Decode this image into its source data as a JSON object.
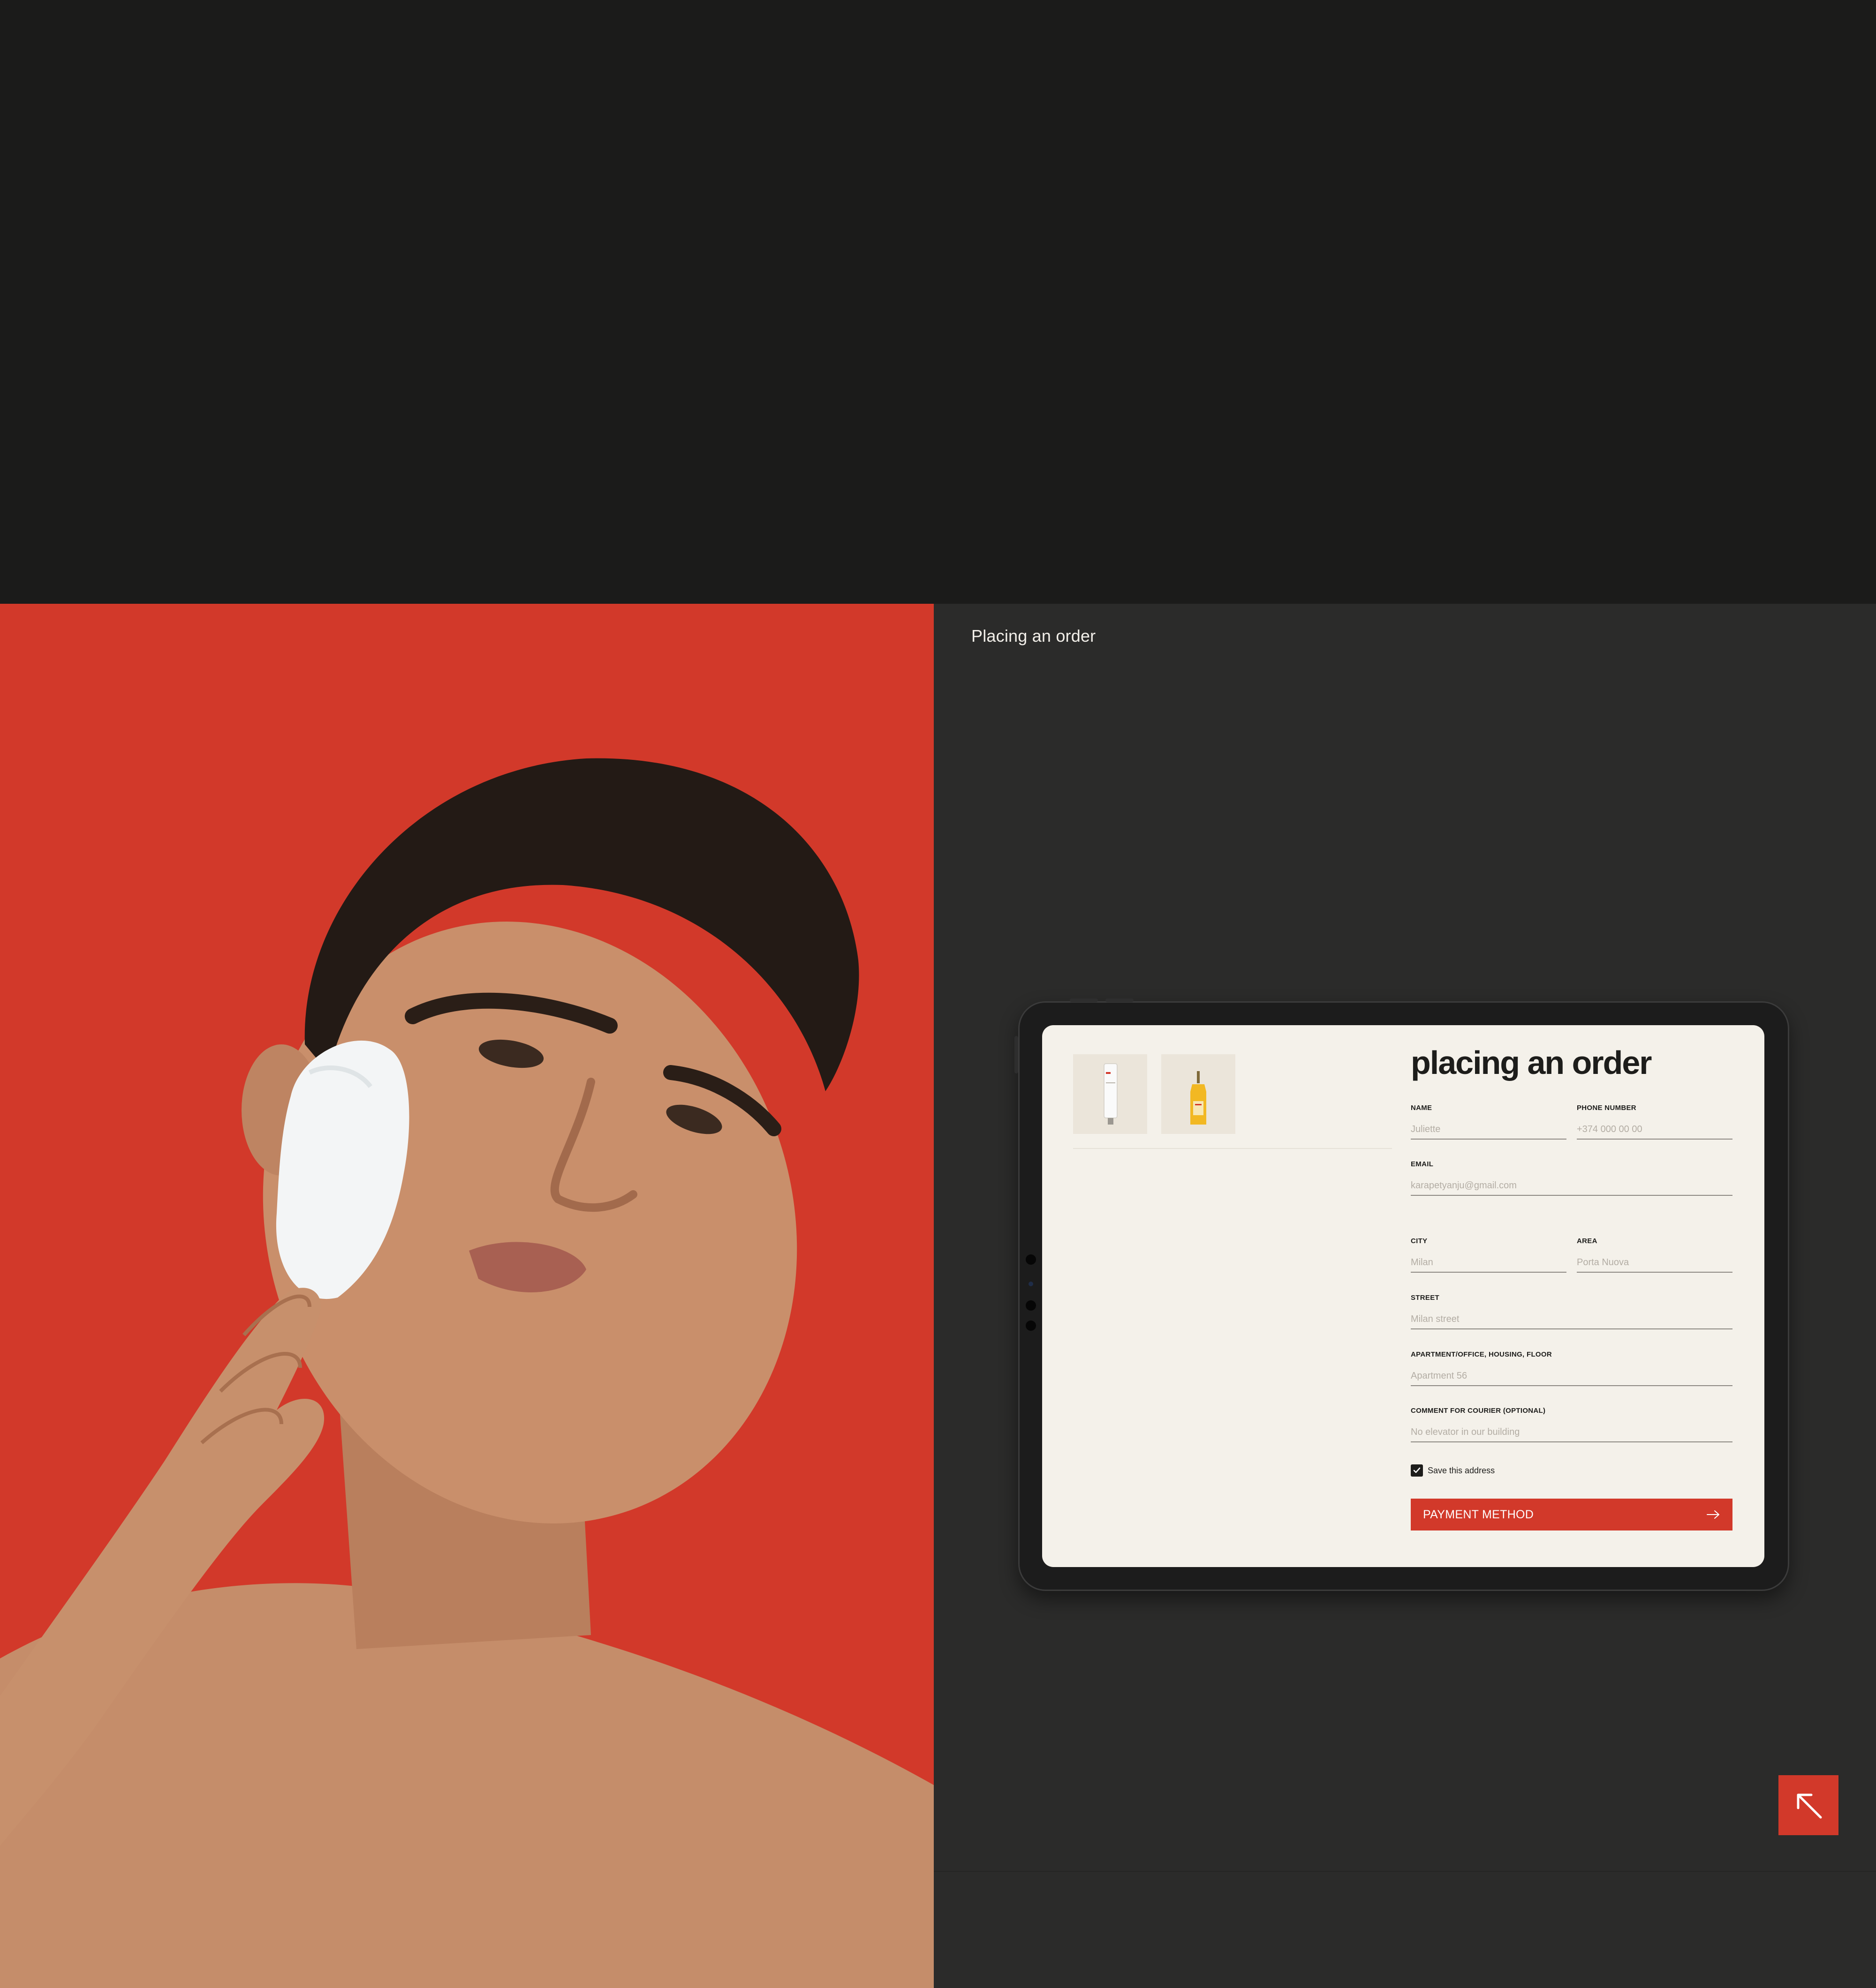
{
  "section": {
    "title": "Placing an order"
  },
  "form": {
    "title": "placing an order",
    "fields": {
      "name": {
        "label": "NAME",
        "placeholder": "Juliette"
      },
      "phone": {
        "label": "PHONE NUMBER",
        "placeholder": "+374 000 00 00"
      },
      "email": {
        "label": "EMAIL",
        "placeholder": "karapetyanju@gmail.com"
      },
      "city": {
        "label": "CITY",
        "placeholder": "Milan"
      },
      "area": {
        "label": "AREA",
        "placeholder": "Porta Nuova"
      },
      "street": {
        "label": "STREET",
        "placeholder": "Milan street"
      },
      "apartment": {
        "label": "APARTMENT/OFFICE, HOUSING, FLOOR",
        "placeholder": "Apartment 56"
      },
      "comment": {
        "label": "COMMENT FOR COURIER (OPTIONAL)",
        "placeholder": "No elevator in our building"
      }
    },
    "save_address": {
      "label": "Save this address",
      "checked": true
    },
    "submit": {
      "label": "PAYMENT METHOD"
    }
  },
  "colors": {
    "accent": "#d2392a",
    "panel_dark": "#2b2b2a",
    "page_dark": "#1b1b1a",
    "screen_bg": "#f4f1ea"
  },
  "icons": {
    "submit": "arrow-right-icon",
    "corner": "arrow-up-left-icon",
    "checkbox": "checkmark-icon"
  }
}
